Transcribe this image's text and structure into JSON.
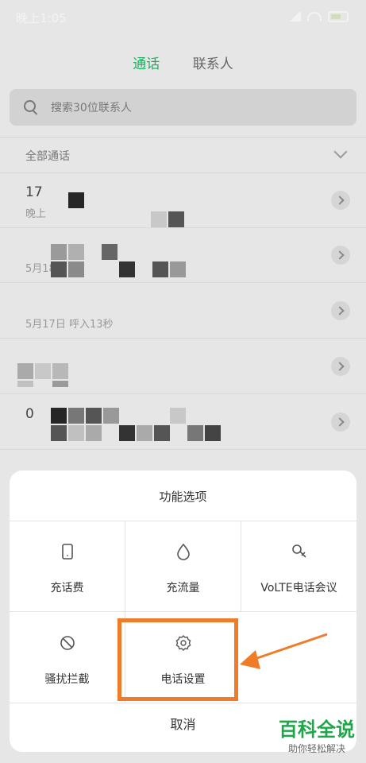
{
  "status": {
    "time": "晚上1:05"
  },
  "tabs": [
    {
      "label": "通话"
    },
    {
      "label": "联系人"
    }
  ],
  "search": {
    "placeholder": "搜索30位联系人"
  },
  "filter": {
    "label": "全部通话"
  },
  "calls": [
    {
      "line1": "17",
      "line2": "晚上"
    },
    {
      "line1": "",
      "line2": "5月18日"
    },
    {
      "line1": "",
      "line2": "5月17日 呼入13秒"
    },
    {
      "line1": "",
      "line2": ""
    },
    {
      "line1": "0",
      "line2": ""
    }
  ],
  "sheet": {
    "title": "功能选项",
    "options": [
      {
        "label": "充话费",
        "icon": "phone-icon"
      },
      {
        "label": "充流量",
        "icon": "drop-icon"
      },
      {
        "label": "VoLTE电话会议",
        "icon": "conference-icon"
      },
      {
        "label": "骚扰拦截",
        "icon": "block-icon"
      },
      {
        "label": "电话设置",
        "icon": "gear-icon"
      }
    ],
    "cancel": "取消"
  },
  "watermark": {
    "title": "百科全说",
    "subtitle": "助你轻松解决"
  },
  "colors": {
    "accent": "#1fae5f",
    "highlight": "#f07c2a"
  }
}
